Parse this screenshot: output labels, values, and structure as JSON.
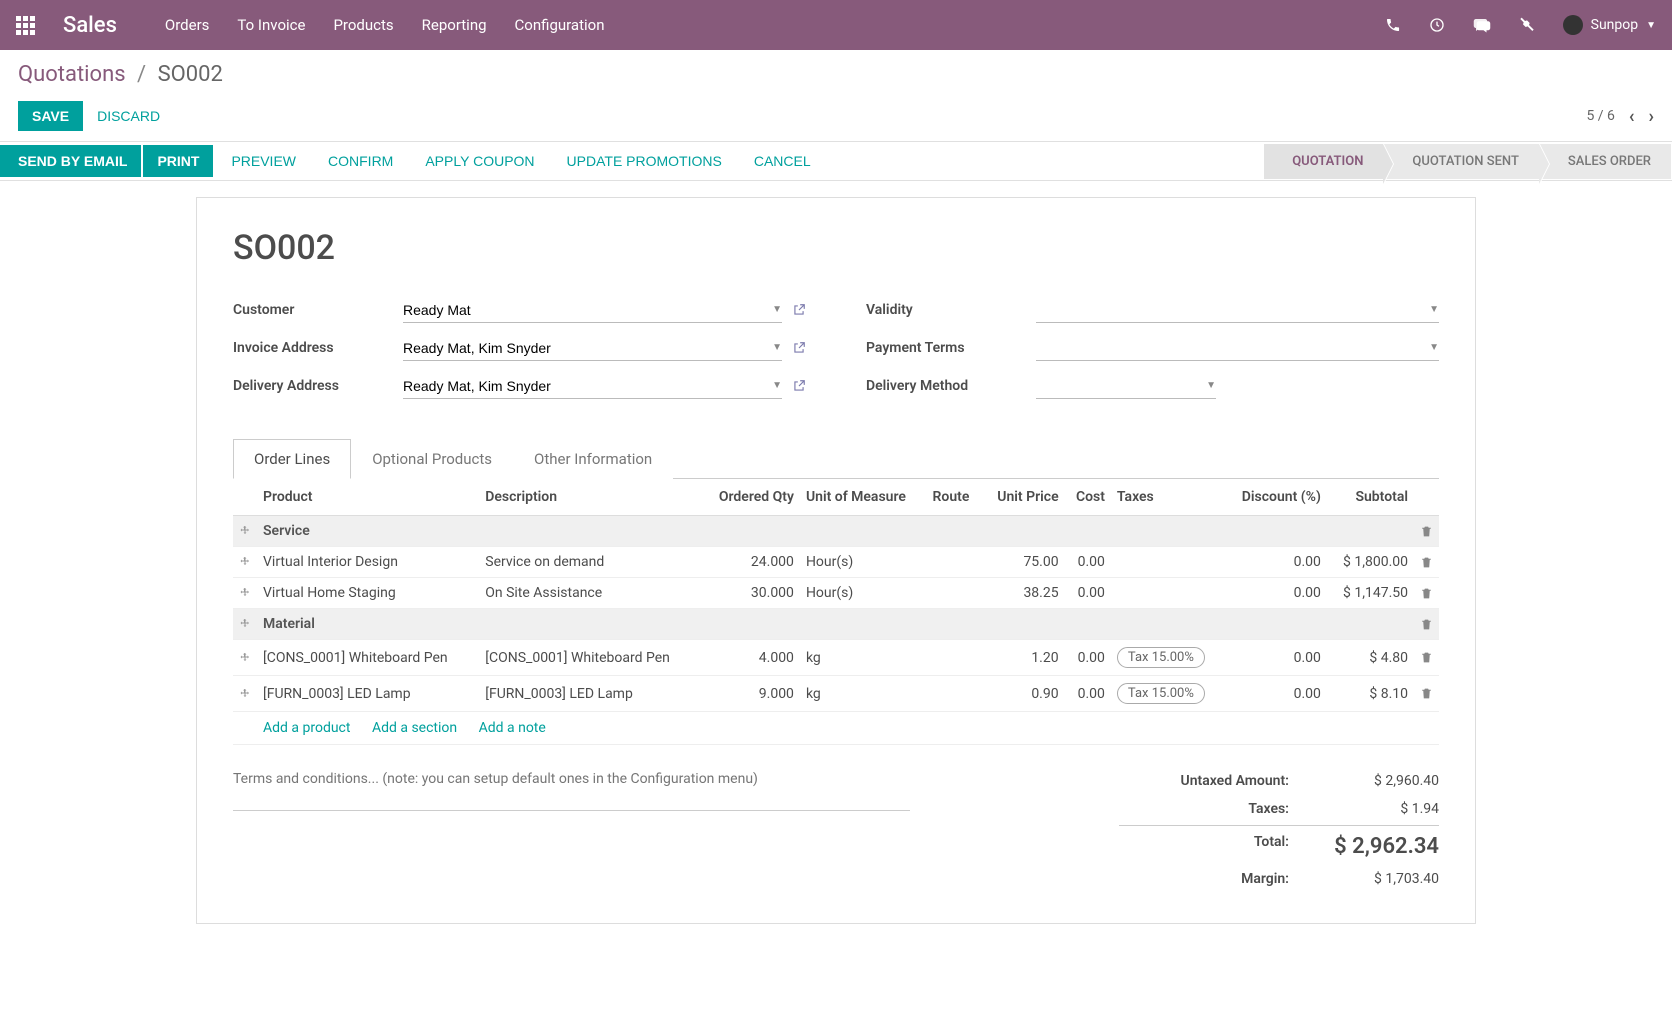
{
  "navbar": {
    "brand": "Sales",
    "menu": [
      "Orders",
      "To Invoice",
      "Products",
      "Reporting",
      "Configuration"
    ],
    "user": "Sunpop"
  },
  "breadcrumb": {
    "root": "Quotations",
    "current": "SO002"
  },
  "buttons": {
    "save": "SAVE",
    "discard": "DISCARD"
  },
  "pager": {
    "text": "5 / 6"
  },
  "status_actions": {
    "send_email": "SEND BY EMAIL",
    "print": "PRINT",
    "preview": "PREVIEW",
    "confirm": "CONFIRM",
    "apply_coupon": "APPLY COUPON",
    "update_promotions": "UPDATE PROMOTIONS",
    "cancel": "CANCEL"
  },
  "stages": {
    "quotation": "QUOTATION",
    "quotation_sent": "QUOTATION SENT",
    "sales_order": "SALES ORDER"
  },
  "order": {
    "name": "SO002",
    "labels": {
      "customer": "Customer",
      "invoice_address": "Invoice Address",
      "delivery_address": "Delivery Address",
      "validity": "Validity",
      "payment_terms": "Payment Terms",
      "delivery_method": "Delivery Method"
    },
    "customer": "Ready Mat",
    "invoice_address": "Ready Mat, Kim Snyder",
    "delivery_address": "Ready Mat, Kim Snyder",
    "validity": "",
    "payment_terms": "",
    "delivery_method": ""
  },
  "tabs": {
    "order_lines": "Order Lines",
    "optional_products": "Optional Products",
    "other_information": "Other Information"
  },
  "columns": {
    "product": "Product",
    "description": "Description",
    "ordered_qty": "Ordered Qty",
    "uom": "Unit of Measure",
    "route": "Route",
    "unit_price": "Unit Price",
    "cost": "Cost",
    "taxes": "Taxes",
    "discount": "Discount (%)",
    "subtotal": "Subtotal"
  },
  "lines": [
    {
      "type": "section",
      "name": "Service"
    },
    {
      "type": "product",
      "product": "Virtual Interior Design",
      "description": "Service on demand",
      "qty": "24.000",
      "uom": "Hour(s)",
      "route": "",
      "unit_price": "75.00",
      "cost": "0.00",
      "tax": "",
      "discount": "0.00",
      "subtotal": "$ 1,800.00"
    },
    {
      "type": "product",
      "product": "Virtual Home Staging",
      "description": "On Site Assistance",
      "qty": "30.000",
      "uom": "Hour(s)",
      "route": "",
      "unit_price": "38.25",
      "cost": "0.00",
      "tax": "",
      "discount": "0.00",
      "subtotal": "$ 1,147.50"
    },
    {
      "type": "section",
      "name": "Material"
    },
    {
      "type": "product",
      "product": "[CONS_0001] Whiteboard Pen",
      "description": "[CONS_0001] Whiteboard Pen",
      "qty": "4.000",
      "uom": "kg",
      "route": "",
      "unit_price": "1.20",
      "cost": "0.00",
      "tax": "Tax 15.00%",
      "discount": "0.00",
      "subtotal": "$ 4.80"
    },
    {
      "type": "product",
      "product": "[FURN_0003] LED Lamp",
      "description": "[FURN_0003] LED Lamp",
      "qty": "9.000",
      "uom": "kg",
      "route": "",
      "unit_price": "0.90",
      "cost": "0.00",
      "tax": "Tax 15.00%",
      "discount": "0.00",
      "subtotal": "$ 8.10"
    }
  ],
  "add_links": {
    "product": "Add a product",
    "section": "Add a section",
    "note": "Add a note"
  },
  "terms_placeholder": "Terms and conditions... (note: you can setup default ones in the Configuration menu)",
  "totals": {
    "untaxed_label": "Untaxed Amount:",
    "untaxed": "$ 2,960.40",
    "taxes_label": "Taxes:",
    "taxes": "$ 1.94",
    "total_label": "Total:",
    "total": "$ 2,962.34",
    "margin_label": "Margin:",
    "margin": "$ 1,703.40"
  }
}
